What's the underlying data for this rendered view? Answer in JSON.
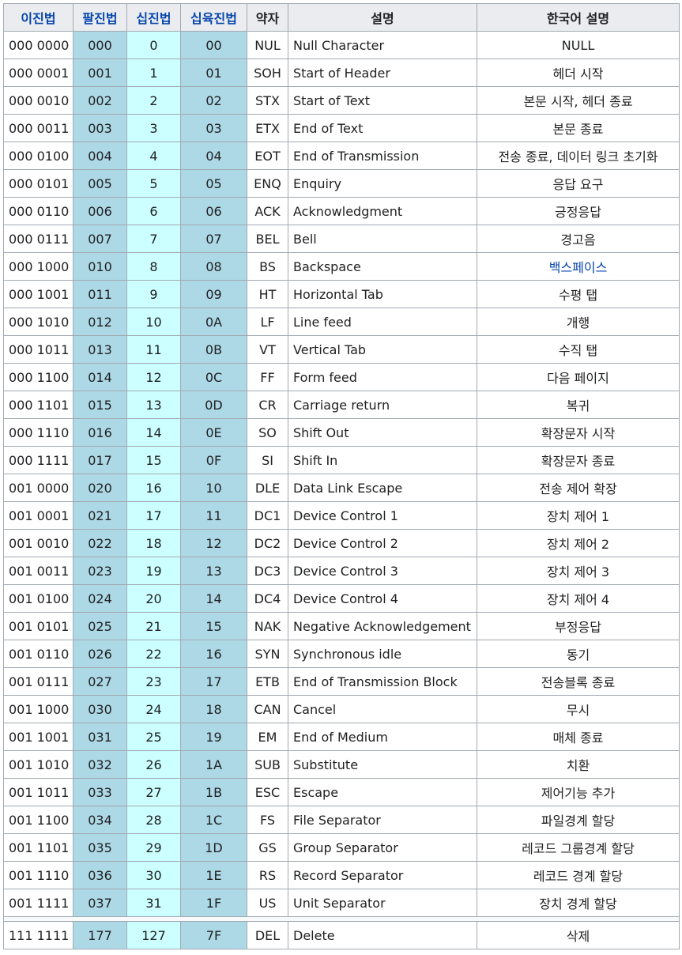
{
  "headers": {
    "binary": "이진법",
    "octal": "팔진법",
    "decimal": "십진법",
    "hex": "십육진법",
    "abbr": "약자",
    "desc": "설명",
    "korean": "한국어 설명"
  },
  "rows": [
    {
      "bin": "000 0000",
      "oct": "000",
      "dec": "0",
      "hex": "00",
      "abbr": "NUL",
      "name": "Null Character",
      "ko": "NULL"
    },
    {
      "bin": "000 0001",
      "oct": "001",
      "dec": "1",
      "hex": "01",
      "abbr": "SOH",
      "name": "Start of Header",
      "ko": "헤더 시작"
    },
    {
      "bin": "000 0010",
      "oct": "002",
      "dec": "2",
      "hex": "02",
      "abbr": "STX",
      "name": "Start of Text",
      "ko": "본문 시작, 헤더 종료"
    },
    {
      "bin": "000 0011",
      "oct": "003",
      "dec": "3",
      "hex": "03",
      "abbr": "ETX",
      "name": "End of Text",
      "ko": "본문 종료"
    },
    {
      "bin": "000 0100",
      "oct": "004",
      "dec": "4",
      "hex": "04",
      "abbr": "EOT",
      "name": "End of Transmission",
      "ko": "전송 종료, 데이터 링크 초기화"
    },
    {
      "bin": "000 0101",
      "oct": "005",
      "dec": "5",
      "hex": "05",
      "abbr": "ENQ",
      "name": "Enquiry",
      "ko": "응답 요구"
    },
    {
      "bin": "000 0110",
      "oct": "006",
      "dec": "6",
      "hex": "06",
      "abbr": "ACK",
      "name": "Acknowledgment",
      "ko": "긍정응답"
    },
    {
      "bin": "000 0111",
      "oct": "007",
      "dec": "7",
      "hex": "07",
      "abbr": "BEL",
      "name": "Bell",
      "ko": "경고음"
    },
    {
      "bin": "000 1000",
      "oct": "010",
      "dec": "8",
      "hex": "08",
      "abbr": "BS",
      "name": "Backspace",
      "ko": "백스페이스"
    },
    {
      "bin": "000 1001",
      "oct": "011",
      "dec": "9",
      "hex": "09",
      "abbr": "HT",
      "name": "Horizontal Tab",
      "ko": "수평 탭"
    },
    {
      "bin": "000 1010",
      "oct": "012",
      "dec": "10",
      "hex": "0A",
      "abbr": "LF",
      "name": "Line feed",
      "ko": "개행"
    },
    {
      "bin": "000 1011",
      "oct": "013",
      "dec": "11",
      "hex": "0B",
      "abbr": "VT",
      "name": "Vertical Tab",
      "ko": "수직 탭"
    },
    {
      "bin": "000 1100",
      "oct": "014",
      "dec": "12",
      "hex": "0C",
      "abbr": "FF",
      "name": "Form feed",
      "ko": "다음 페이지"
    },
    {
      "bin": "000 1101",
      "oct": "015",
      "dec": "13",
      "hex": "0D",
      "abbr": "CR",
      "name": "Carriage return",
      "ko": "복귀"
    },
    {
      "bin": "000 1110",
      "oct": "016",
      "dec": "14",
      "hex": "0E",
      "abbr": "SO",
      "name": "Shift Out",
      "ko": "확장문자 시작"
    },
    {
      "bin": "000 1111",
      "oct": "017",
      "dec": "15",
      "hex": "0F",
      "abbr": "SI",
      "name": "Shift In",
      "ko": "확장문자 종료"
    },
    {
      "bin": "001 0000",
      "oct": "020",
      "dec": "16",
      "hex": "10",
      "abbr": "DLE",
      "name": "Data Link Escape",
      "ko": "전송 제어 확장"
    },
    {
      "bin": "001 0001",
      "oct": "021",
      "dec": "17",
      "hex": "11",
      "abbr": "DC1",
      "name": "Device Control 1",
      "ko": "장치 제어 1"
    },
    {
      "bin": "001 0010",
      "oct": "022",
      "dec": "18",
      "hex": "12",
      "abbr": "DC2",
      "name": "Device Control 2",
      "ko": "장치 제어 2"
    },
    {
      "bin": "001 0011",
      "oct": "023",
      "dec": "19",
      "hex": "13",
      "abbr": "DC3",
      "name": "Device Control 3",
      "ko": "장치 제어 3"
    },
    {
      "bin": "001 0100",
      "oct": "024",
      "dec": "20",
      "hex": "14",
      "abbr": "DC4",
      "name": "Device Control 4",
      "ko": "장치 제어 4"
    },
    {
      "bin": "001 0101",
      "oct": "025",
      "dec": "21",
      "hex": "15",
      "abbr": "NAK",
      "name": "Negative Acknowledgement",
      "ko": "부정응답"
    },
    {
      "bin": "001 0110",
      "oct": "026",
      "dec": "22",
      "hex": "16",
      "abbr": "SYN",
      "name": "Synchronous idle",
      "ko": "동기"
    },
    {
      "bin": "001 0111",
      "oct": "027",
      "dec": "23",
      "hex": "17",
      "abbr": "ETB",
      "name": "End of Transmission Block",
      "ko": "전송블록 종료"
    },
    {
      "bin": "001 1000",
      "oct": "030",
      "dec": "24",
      "hex": "18",
      "abbr": "CAN",
      "name": "Cancel",
      "ko": "무시"
    },
    {
      "bin": "001 1001",
      "oct": "031",
      "dec": "25",
      "hex": "19",
      "abbr": "EM",
      "name": "End of Medium",
      "ko": "매체 종료"
    },
    {
      "bin": "001 1010",
      "oct": "032",
      "dec": "26",
      "hex": "1A",
      "abbr": "SUB",
      "name": "Substitute",
      "ko": "치환"
    },
    {
      "bin": "001 1011",
      "oct": "033",
      "dec": "27",
      "hex": "1B",
      "abbr": "ESC",
      "name": "Escape",
      "ko": "제어기능 추가"
    },
    {
      "bin": "001 1100",
      "oct": "034",
      "dec": "28",
      "hex": "1C",
      "abbr": "FS",
      "name": "File Separator",
      "ko": "파일경계 할당"
    },
    {
      "bin": "001 1101",
      "oct": "035",
      "dec": "29",
      "hex": "1D",
      "abbr": "GS",
      "name": "Group Separator",
      "ko": "레코드 그룹경계 할당"
    },
    {
      "bin": "001 1110",
      "oct": "036",
      "dec": "30",
      "hex": "1E",
      "abbr": "RS",
      "name": "Record Separator",
      "ko": "레코드 경계 할당"
    },
    {
      "bin": "001 1111",
      "oct": "037",
      "dec": "31",
      "hex": "1F",
      "abbr": "US",
      "name": "Unit Separator",
      "ko": "장치 경계 할당"
    }
  ],
  "del_row": {
    "bin": "111 1111",
    "oct": "177",
    "dec": "127",
    "hex": "7F",
    "abbr": "DEL",
    "name": "Delete",
    "ko": "삭제"
  },
  "linked_korean": [
    "백스페이스"
  ],
  "colors": {
    "header_bg": "#eaecf0",
    "octal_bg": "#add8e6",
    "decimal_bg": "#ccffff",
    "hex_bg": "#add8e6",
    "link": "#0645ad",
    "border": "#a2a9b1"
  }
}
